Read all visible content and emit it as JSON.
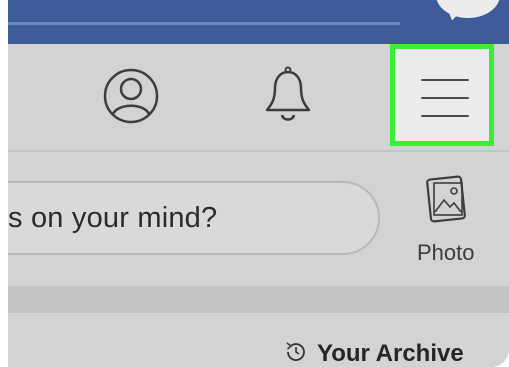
{
  "header": {
    "icons": [
      "search-line",
      "messenger-icon"
    ]
  },
  "nav": {
    "profile_icon": "profile-icon",
    "notifications_icon": "bell-icon",
    "menu_icon": "hamburger-menu-icon",
    "highlight_color": "#39ee39"
  },
  "composer": {
    "placeholder": "s on your mind?",
    "photo_label": "Photo",
    "photo_icon": "photo-icon"
  },
  "archive": {
    "label": "Your Archive",
    "icon": "archive-clock-icon"
  },
  "colors": {
    "top_bar": "#3f5c9a",
    "background": "#d3d3d3",
    "highlight": "#39ee39"
  }
}
